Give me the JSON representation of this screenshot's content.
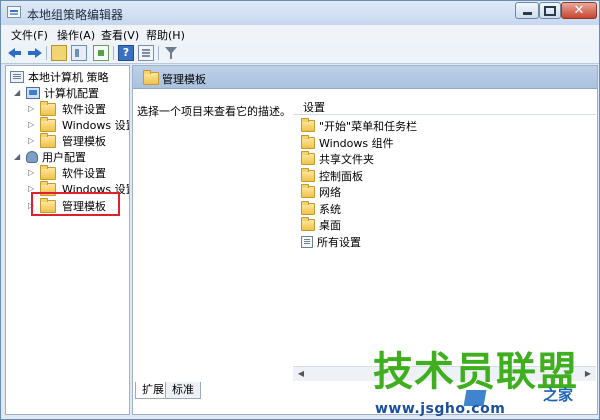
{
  "window": {
    "title": "本地组策略编辑器"
  },
  "menu": [
    {
      "label": "文件(F)"
    },
    {
      "label": "操作(A)"
    },
    {
      "label": "查看(V)"
    },
    {
      "label": "帮助(H)"
    }
  ],
  "toolbar": {
    "help_label": "?"
  },
  "tree": {
    "root": "本地计算机 策略",
    "computer_config": "计算机配置",
    "computer_children": [
      "软件设置",
      "Windows 设置",
      "管理模板"
    ],
    "user_config": "用户配置",
    "user_children": [
      "软件设置",
      "Windows 设置",
      "管理模板"
    ]
  },
  "right": {
    "header_title": "管理模板",
    "description": "选择一个项目来查看它的描述。",
    "column_header": "设置",
    "items": [
      "\"开始\"菜单和任务栏",
      "Windows 组件",
      "共享文件夹",
      "控制面板",
      "网络",
      "系统",
      "桌面",
      "所有设置"
    ],
    "tabs": [
      "扩展",
      "标准"
    ]
  },
  "watermark": {
    "big_text": "技术员联盟",
    "sub_text": "之家",
    "url": "www.jsgho.com"
  },
  "colors": {
    "highlight": "#e0212b",
    "watermark_green": "#3fae1f",
    "watermark_blue": "#1a4fa0"
  }
}
